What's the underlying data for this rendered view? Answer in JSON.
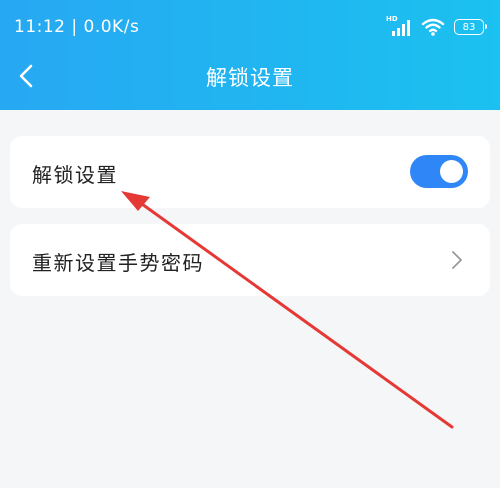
{
  "status_bar": {
    "time_speed": "11:12 | 0.0K/s",
    "network_type": "HD",
    "battery_level": "83"
  },
  "header": {
    "title": "解锁设置",
    "back_icon": "chevron-left-icon"
  },
  "settings": {
    "unlock_setting": {
      "label": "解锁设置",
      "enabled": true
    },
    "reset_gesture": {
      "label": "重新设置手势密码",
      "icon": "chevron-right-icon"
    }
  },
  "colors": {
    "header_gradient_start": "#27a8f2",
    "header_gradient_end": "#1bc1f0",
    "toggle_on": "#2f86f6",
    "annotation_arrow": "#e53935",
    "page_background": "#f5f6f8"
  }
}
